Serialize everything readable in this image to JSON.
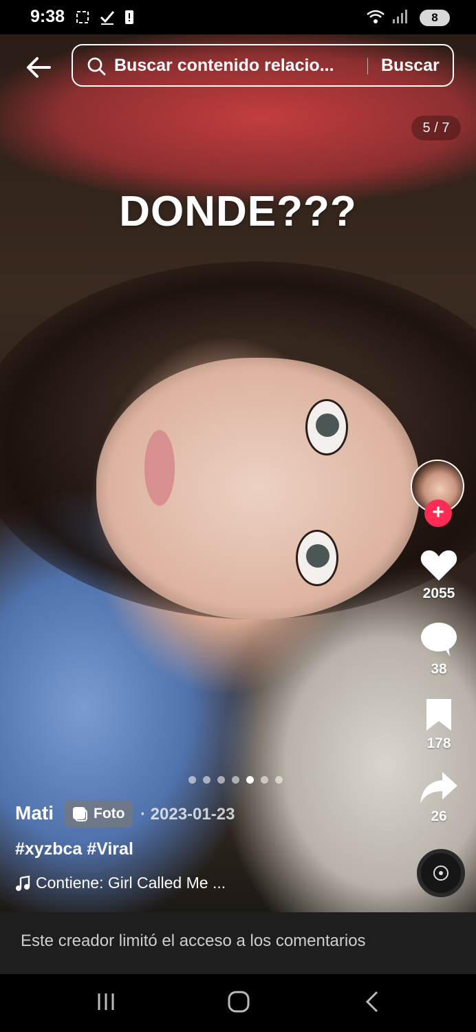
{
  "status_bar": {
    "time": "9:38",
    "battery": "8"
  },
  "header": {
    "search_placeholder": "Buscar contenido relacio...",
    "search_button": "Buscar"
  },
  "post": {
    "overlay_text": "DONDE???",
    "photo_counter": "5 / 7",
    "photo_count": 7,
    "active_photo": 5,
    "author": "Mati",
    "type_label": "Foto",
    "date": "· 2023-01-23",
    "hashtags": "#xyzbca #Viral",
    "music": "Contiene: Girl Called Me ..."
  },
  "actions": {
    "likes": "2055",
    "comments": "38",
    "saves": "178",
    "shares": "26"
  },
  "comments_notice": "Este creador limitó el acceso a los comentarios",
  "colors": {
    "accent": "#fe2c55",
    "notice_bg": "#1e1e1e"
  }
}
